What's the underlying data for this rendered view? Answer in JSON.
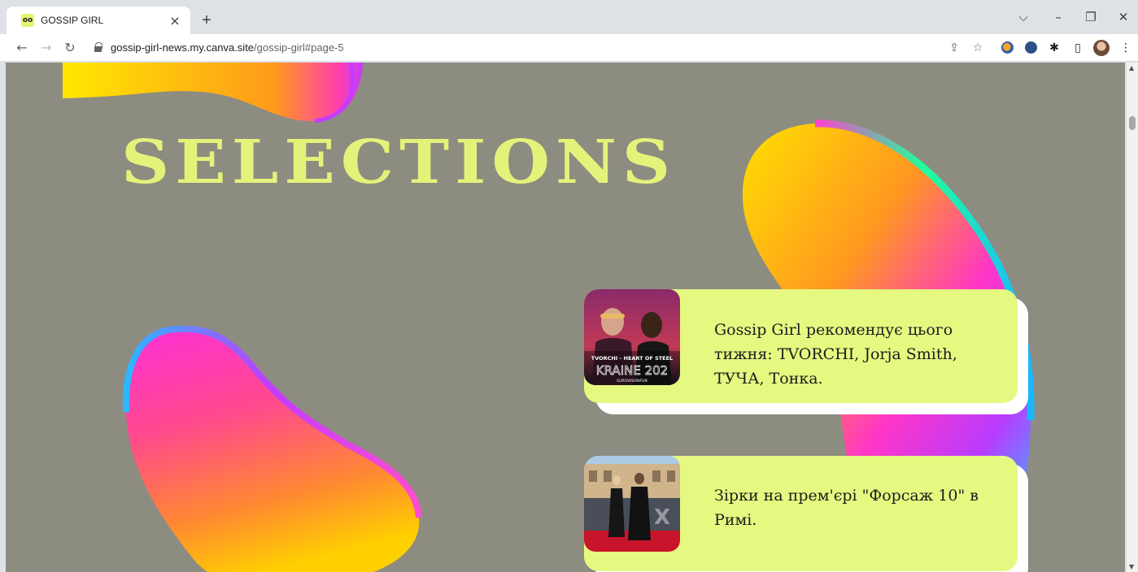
{
  "browser": {
    "tab_title": "GOSSIP GIRL",
    "tab_favicon": "oo",
    "tab_close": "×",
    "new_tab": "+",
    "window_controls": {
      "dropdown": "⌵",
      "minimize": "–",
      "restore": "❐",
      "close": "✕"
    },
    "nav": {
      "back": "←",
      "forward": "→",
      "reload": "↻"
    },
    "url_host": "gossip-girl-news.my.canva.site",
    "url_path": "/gossip-girl#page-5",
    "toolbar_icons": {
      "share": "⇪",
      "bookmark": "☆",
      "extensions": "✱",
      "side_panel": "▯",
      "menu": "⋮"
    }
  },
  "page": {
    "title": "SELECTIONS",
    "cards": [
      {
        "text": "Gossip Girl рекомендує цього тижня: TVORCHI, Jorja Smith, ТУЧА, Тонка.",
        "thumb_line1": "TVORCHI - HEART OF STEEL",
        "thumb_line2": "KRAINE 202",
        "thumb_line3": "EUROVISIONFUN"
      },
      {
        "text": "Зірки на прем'єрі \"Форсаж 10\" в Римі."
      }
    ]
  },
  "colors": {
    "page_background": "#8d8c81",
    "title": "#e3f37a",
    "card": "#e5f981"
  }
}
